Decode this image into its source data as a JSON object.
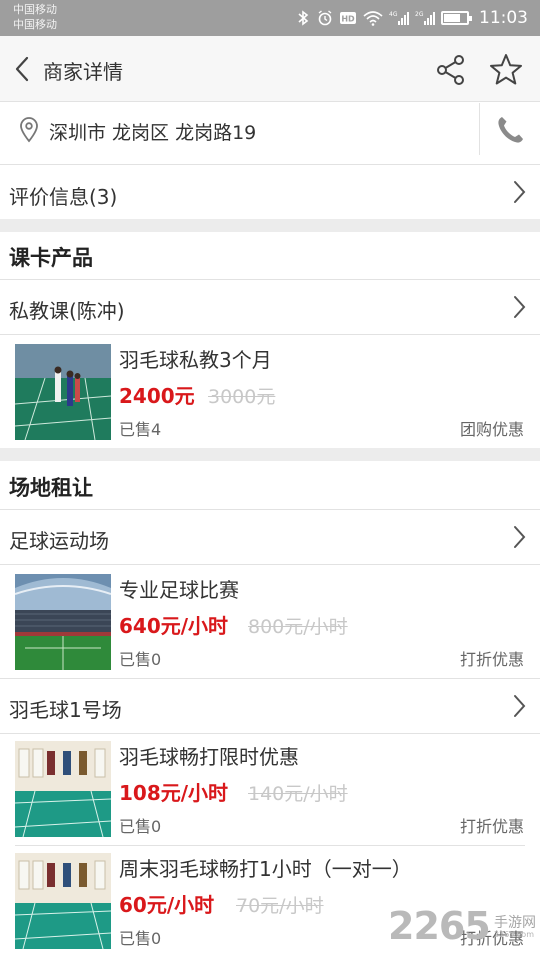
{
  "status_bar": {
    "carrier_1": "中国移动",
    "carrier_2": "中国移动",
    "time": "11:03",
    "icons": [
      "bluetooth-icon",
      "alarm-icon",
      "hd-icon",
      "wifi-icon",
      "signal-icon",
      "signal-icon",
      "battery-icon"
    ]
  },
  "app_bar": {
    "title": "商家详情",
    "back_icon": "chevron-left-icon",
    "share_icon": "share-icon",
    "favorite_icon": "star-outline-icon"
  },
  "address": {
    "text": "深圳市 龙岗区 龙岗路19",
    "pin_icon": "location-pin-icon",
    "phone_icon": "phone-icon"
  },
  "reviews": {
    "label": "评价信息(3)"
  },
  "course_section": {
    "title": "课卡产品",
    "groups": [
      {
        "label": "私教课(陈冲)",
        "products": [
          {
            "name": "羽毛球私教3个月",
            "price": "2400元",
            "original_price": "3000元",
            "sold": "已售4",
            "tag": "团购优惠"
          }
        ]
      }
    ]
  },
  "venue_section": {
    "title": "场地租让",
    "groups": [
      {
        "label": "足球运动场",
        "products": [
          {
            "name": "专业足球比赛",
            "price": "640元/小时",
            "original_price": "800元/小时",
            "sold": "已售0",
            "tag": "打折优惠"
          }
        ]
      },
      {
        "label": "羽毛球1号场",
        "products": [
          {
            "name": "羽毛球畅打限时优惠",
            "price": "108元/小时",
            "original_price": "140元/小时",
            "sold": "已售0",
            "tag": "打折优惠"
          },
          {
            "name": "周末羽毛球畅打1小时（一对一）",
            "price": "60元/小时",
            "original_price": "70元/小时",
            "sold": "已售0",
            "tag": "打折优惠"
          }
        ]
      }
    ]
  },
  "watermark": {
    "number": "2265",
    "text": "手游网",
    "url": "2265.com"
  },
  "colors": {
    "price_red": "#d9181b",
    "status_bar": "#9e9e9e",
    "section_gap": "#ececec",
    "divider": "#e2e2e2"
  }
}
